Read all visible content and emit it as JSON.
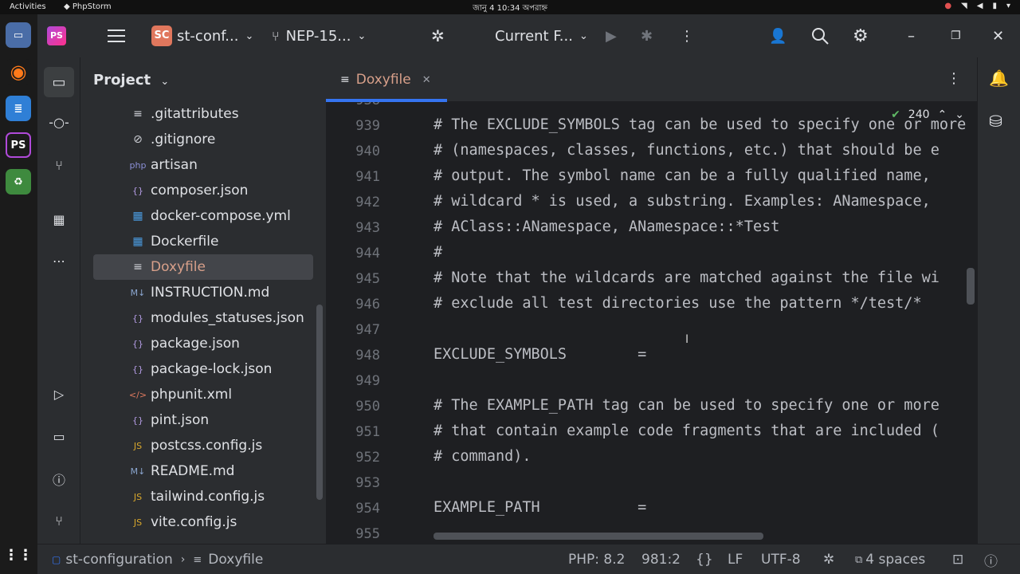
{
  "os_bar": {
    "activities": "Activities",
    "app_name": "PhpStorm",
    "clock": "জানু 4  10:34 অপরাহ্ন"
  },
  "toolbar": {
    "project_badge": "SC",
    "project_name": "st-conf...",
    "branch": "NEP-15...",
    "run_config": "Current F..."
  },
  "project_panel": {
    "title": "Project",
    "items": [
      {
        "icon": "gitattributes-file-icon",
        "glyph": "≡",
        "label": ".gitattributes"
      },
      {
        "icon": "gitignore-file-icon",
        "glyph": "⊘",
        "label": ".gitignore"
      },
      {
        "icon": "php-file-icon",
        "glyph": "php",
        "label": "artisan"
      },
      {
        "icon": "json-file-icon",
        "glyph": "{}",
        "label": "composer.json"
      },
      {
        "icon": "docker-compose-file-icon",
        "glyph": "▦",
        "label": "docker-compose.yml"
      },
      {
        "icon": "dockerfile-icon",
        "glyph": "▦",
        "label": "Dockerfile"
      },
      {
        "icon": "text-file-icon",
        "glyph": "≡",
        "label": "Doxyfile"
      },
      {
        "icon": "markdown-file-icon",
        "glyph": "M↓",
        "label": "INSTRUCTION.md"
      },
      {
        "icon": "json-file-icon",
        "glyph": "{}",
        "label": "modules_statuses.json"
      },
      {
        "icon": "json-file-icon",
        "glyph": "{}",
        "label": "package.json"
      },
      {
        "icon": "json-file-icon",
        "glyph": "{}",
        "label": "package-lock.json"
      },
      {
        "icon": "xml-file-icon",
        "glyph": "</>",
        "label": "phpunit.xml"
      },
      {
        "icon": "json-file-icon",
        "glyph": "{}",
        "label": "pint.json"
      },
      {
        "icon": "js-file-icon",
        "glyph": "JS",
        "label": "postcss.config.js"
      },
      {
        "icon": "markdown-file-icon",
        "glyph": "M↓",
        "label": "README.md"
      },
      {
        "icon": "js-file-icon",
        "glyph": "JS",
        "label": "tailwind.config.js"
      },
      {
        "icon": "js-file-icon",
        "glyph": "JS",
        "label": "vite.config.js"
      }
    ],
    "selected_label": "Doxyfile"
  },
  "editor": {
    "tab_label": "Doxyfile",
    "inspection_count": "240",
    "partial_top_line": "938",
    "lines": [
      {
        "num": "939",
        "text": "# The EXCLUDE_SYMBOLS tag can be used to specify one or more"
      },
      {
        "num": "940",
        "text": "# (namespaces, classes, functions, etc.) that should be e"
      },
      {
        "num": "941",
        "text": "# output. The symbol name can be a fully qualified name, "
      },
      {
        "num": "942",
        "text": "# wildcard * is used, a substring. Examples: ANamespace, "
      },
      {
        "num": "943",
        "text": "# AClass::ANamespace, ANamespace::*Test"
      },
      {
        "num": "944",
        "text": "#"
      },
      {
        "num": "945",
        "text": "# Note that the wildcards are matched against the file wi"
      },
      {
        "num": "946",
        "text": "# exclude all test directories use the pattern */test/*"
      },
      {
        "num": "947",
        "text": ""
      },
      {
        "num": "948",
        "text": "EXCLUDE_SYMBOLS        ="
      },
      {
        "num": "949",
        "text": ""
      },
      {
        "num": "950",
        "text": "# The EXAMPLE_PATH tag can be used to specify one or more"
      },
      {
        "num": "951",
        "text": "# that contain example code fragments that are included ("
      },
      {
        "num": "952",
        "text": "# command)."
      },
      {
        "num": "953",
        "text": ""
      },
      {
        "num": "954",
        "text": "EXAMPLE_PATH           ="
      },
      {
        "num": "955",
        "text": ""
      }
    ]
  },
  "status_bar": {
    "project": "st-configuration",
    "file": "Doxyfile",
    "php_version": "PHP: 8.2",
    "position": "981:2",
    "line_ending": "LF",
    "encoding": "UTF-8",
    "indent": "4 spaces"
  },
  "colors": {
    "accent": "#3574f0",
    "project_badge": "#e0775d",
    "selected_file": "#d8a08a"
  }
}
